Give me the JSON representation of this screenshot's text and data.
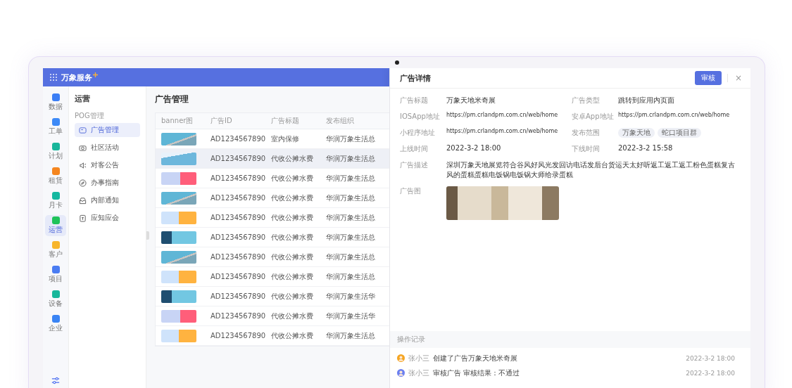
{
  "topbar": {
    "logo": "万象服务"
  },
  "rail": [
    {
      "label": "数据",
      "color": "#3b7ef5",
      "selected": false
    },
    {
      "label": "工单",
      "color": "#3d8af7",
      "selected": false
    },
    {
      "label": "计划",
      "color": "#18b69b",
      "selected": false
    },
    {
      "label": "租赁",
      "color": "#f5861f",
      "selected": false
    },
    {
      "label": "月卡",
      "color": "#14b8a0",
      "selected": false
    },
    {
      "label": "运营",
      "color": "#1fc35a",
      "selected": true
    },
    {
      "label": "客户",
      "color": "#f7b52c",
      "selected": false
    },
    {
      "label": "项目",
      "color": "#4a7cf2",
      "selected": false
    },
    {
      "label": "设备",
      "color": "#17b79b",
      "selected": false
    },
    {
      "label": "企业",
      "color": "#3a84f4",
      "selected": false
    }
  ],
  "subnav": {
    "title": "运营",
    "group": "POG管理",
    "items": [
      {
        "label": "广告管理",
        "selected": true
      },
      {
        "label": "社区活动",
        "selected": false
      },
      {
        "label": "对客公告",
        "selected": false
      },
      {
        "label": "办事指南",
        "selected": false
      },
      {
        "label": "内部通知",
        "selected": false
      },
      {
        "label": "应知应会",
        "selected": false
      }
    ]
  },
  "page": {
    "title": "广告管理"
  },
  "table": {
    "columns": [
      "banner图",
      "广告ID",
      "广告标题",
      "发布组织"
    ],
    "rows": [
      {
        "kind": "sky",
        "id": "AD1234567890",
        "title": "室内保修",
        "org": "华润万象生活总",
        "selected": false
      },
      {
        "kind": "plane",
        "id": "AD1234567890",
        "title": "代收公摊水费",
        "org": "华润万象生活总",
        "selected": true
      },
      {
        "kind": "rocket",
        "id": "AD1234567890",
        "title": "代收公摊水费",
        "org": "华润万象生活总",
        "selected": false
      },
      {
        "kind": "sky",
        "id": "AD1234567890",
        "title": "代收公摊水费",
        "org": "华润万象生活总",
        "selected": false
      },
      {
        "kind": "balloon",
        "id": "AD1234567890",
        "title": "代收公摊水费",
        "org": "华润万象生活总",
        "selected": false
      },
      {
        "kind": "tower",
        "id": "AD1234567890",
        "title": "代收公摊水费",
        "org": "华润万象生活总",
        "selected": false
      },
      {
        "kind": "sky",
        "id": "AD1234567890",
        "title": "代收公摊水费",
        "org": "华润万象生活总",
        "selected": false
      },
      {
        "kind": "balloon",
        "id": "AD1234567890",
        "title": "代收公摊水费",
        "org": "华润万象生活总",
        "selected": false
      },
      {
        "kind": "tower",
        "id": "AD1234567890",
        "title": "代收公摊水费",
        "org": "华润万象生活华",
        "selected": false
      },
      {
        "kind": "rocket",
        "id": "AD1234567890",
        "title": "代收公摊水费",
        "org": "华润万象生活华",
        "selected": false
      },
      {
        "kind": "balloon",
        "id": "AD1234567890",
        "title": "代收公摊水费",
        "org": "华润万象生活总",
        "selected": false
      }
    ]
  },
  "drawer": {
    "title": "广告详情",
    "action": "审核",
    "close": "×",
    "fields": [
      {
        "kind": "text",
        "label": "广告标题",
        "value": "万象天地米奇展"
      },
      {
        "kind": "text",
        "label": "广告类型",
        "value": "跳转到应用内页面"
      },
      {
        "kind": "url",
        "label": "IOSApp地址",
        "value": "https://pm.crlandpm.com.cn/web/home"
      },
      {
        "kind": "url",
        "label": "安卓App地址",
        "value": "https://pm.crlandpm.com.cn/web/home"
      },
      {
        "kind": "url",
        "label": "小程序地址",
        "value": "https://pm.crlandpm.com.cn/web/home"
      },
      {
        "kind": "tags",
        "label": "发布范围",
        "tags": [
          "万象天地",
          "蛇口项目群"
        ]
      },
      {
        "kind": "text",
        "label": "上线时间",
        "value": "2022-3-2 18:00"
      },
      {
        "kind": "text",
        "label": "下线时间",
        "value": "2022-3-2 15:58"
      }
    ],
    "description": {
      "label": "广告描述",
      "value": "深圳万象天地展览符合谷风好风光发回访电话发后台货运天太好听返工返工返工粉色蛋糕复古风的蛋糕蛋糕电饭锅电饭锅大师给录蛋糕"
    },
    "image": {
      "label": "广告图"
    },
    "log": {
      "title": "操作记录",
      "entries": [
        {
          "user": "张小三",
          "action": "创建了广告万象天地米奇展",
          "time": "2022-3-2 18:00",
          "color": "#f5a623"
        },
        {
          "user": "张小三",
          "action": "审核广告 审核结果：不通过",
          "time": "2022-3-2 18:00",
          "color": "#6b7ff0"
        }
      ]
    }
  }
}
